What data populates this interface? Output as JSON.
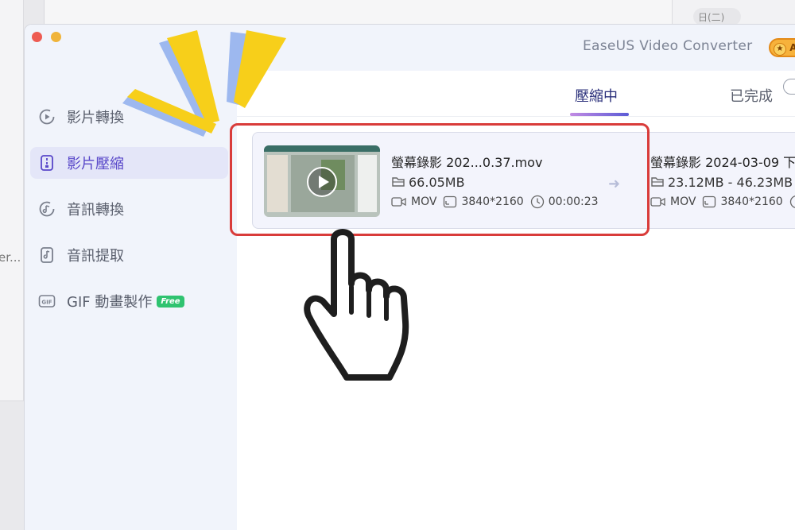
{
  "background": {
    "left_window_text": "er...",
    "date_pill": "日(二)"
  },
  "app": {
    "title": "EaseUS Video Converter",
    "badge_text": "A"
  },
  "sidebar": {
    "items": [
      {
        "label": "影片轉換",
        "icon": "video-convert-icon",
        "active": false
      },
      {
        "label": "影片壓縮",
        "icon": "video-compress-icon",
        "active": true
      },
      {
        "label": "音訊轉換",
        "icon": "audio-convert-icon",
        "active": false
      },
      {
        "label": "音訊提取",
        "icon": "audio-extract-icon",
        "active": false
      },
      {
        "label": "GIF 動畫製作",
        "icon": "gif-icon",
        "active": false,
        "tag": "Free"
      }
    ]
  },
  "tabs": [
    {
      "label": "壓縮中",
      "active": true
    },
    {
      "label": "已完成",
      "active": false
    }
  ],
  "files": [
    {
      "name": "螢幕錄影 202...0.37.mov",
      "size": "66.05MB",
      "format": "MOV",
      "resolution": "3840*2160",
      "duration": "00:00:23"
    },
    {
      "name": "螢幕錄影 2024-03-09 下",
      "size": "23.12MB - 46.23MB",
      "format": "MOV",
      "resolution": "3840*2160"
    }
  ],
  "colors": {
    "accent": "#5847c9",
    "highlight": "#d93c3a",
    "sparkle_yellow": "#f7cf1a",
    "sparkle_blue": "#9db8ef"
  }
}
